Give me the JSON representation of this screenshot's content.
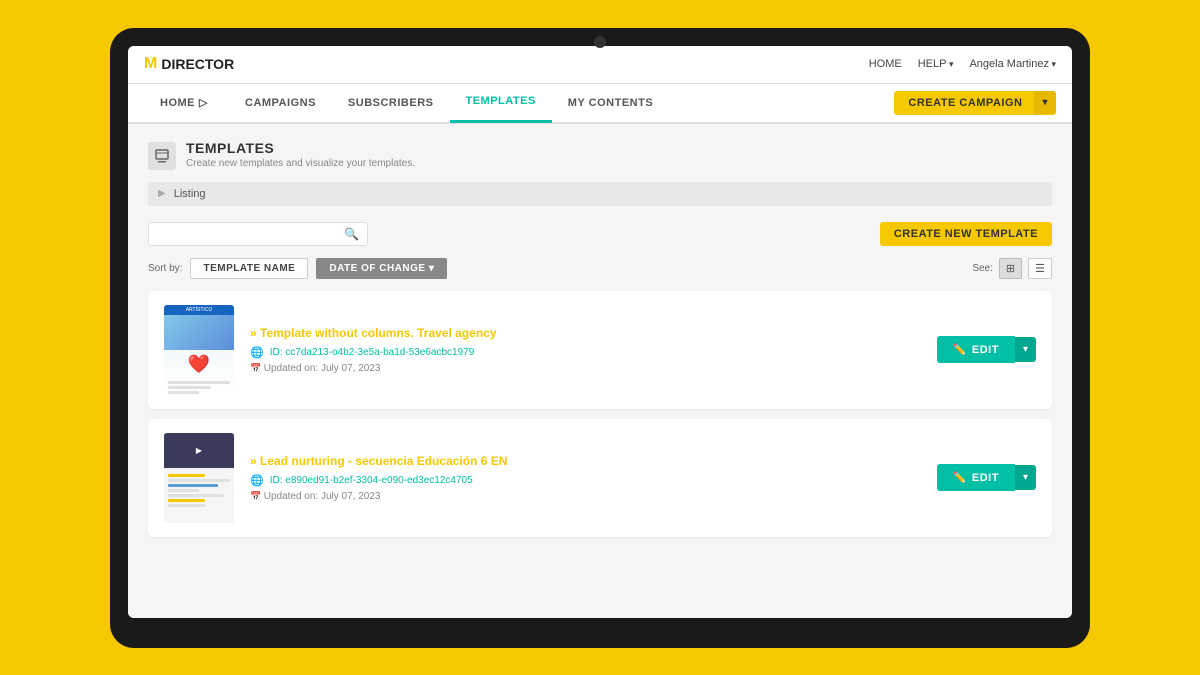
{
  "background_color": "#F5C800",
  "logo": {
    "m": "M",
    "text": "DIRECTOR"
  },
  "top_bar": {
    "home_label": "HOME",
    "help_label": "HELP",
    "user_label": "Angela Martinez"
  },
  "nav": {
    "items": [
      {
        "id": "home",
        "label": "HOME",
        "active": false
      },
      {
        "id": "campaigns",
        "label": "CAMPAIGNS",
        "active": false
      },
      {
        "id": "subscribers",
        "label": "SUBSCRIBERS",
        "active": false
      },
      {
        "id": "templates",
        "label": "TEMPLATES",
        "active": true
      },
      {
        "id": "my-contents",
        "label": "MY CONTENTS",
        "active": false
      }
    ],
    "create_campaign_label": "CREATE CAMPAIGN"
  },
  "page": {
    "title": "TEMPLATES",
    "subtitle": "Create new templates and visualize your templates.",
    "listing_label": "Listing"
  },
  "search": {
    "placeholder": ""
  },
  "create_template_btn": "CREATE NEW TEMPLATE",
  "sort": {
    "by_label": "Sort by:",
    "template_name_label": "TEMPLATE NAME",
    "date_of_change_label": "DATE OF CHANGE ▾",
    "see_label": "See:"
  },
  "templates": [
    {
      "id": "template-1",
      "name": "Template without columns. Travel agency",
      "template_id": "ID: cc7da213-o4b2-3e5a-ba1d-53e6acbc1979",
      "updated": "Updated on: July 07, 2023",
      "type": "travel"
    },
    {
      "id": "template-2",
      "name": "Lead nurturing - secuencia Educación 6 EN",
      "template_id": "ID: e890ed91-b2ef-3304-e090-ed3ec12c4705",
      "updated": "Updated on: July 07, 2023",
      "type": "education"
    }
  ],
  "edit_btn_label": "EDIT"
}
